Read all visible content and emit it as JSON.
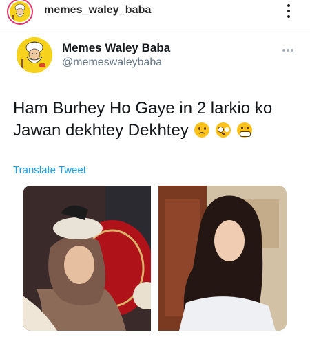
{
  "header": {
    "username": "memes_waley_baba"
  },
  "tweet": {
    "display_name": "Memes Waley Baba",
    "handle": "@memeswaleybaba",
    "text": "Ham Burhey Ho Gaye in 2 larkio ko Jawan dekhtey Dekhtey",
    "emojis": [
      "frowning-face",
      "pleading-face",
      "grimacing-face"
    ],
    "translate_label": "Translate Tweet"
  },
  "colors": {
    "link": "#1da1f2",
    "handle": "#657786",
    "logo_yellow": "#f6d21c"
  },
  "photos": [
    {
      "name": "left-photo",
      "description_visible": false
    },
    {
      "name": "right-photo",
      "description_visible": false
    }
  ]
}
